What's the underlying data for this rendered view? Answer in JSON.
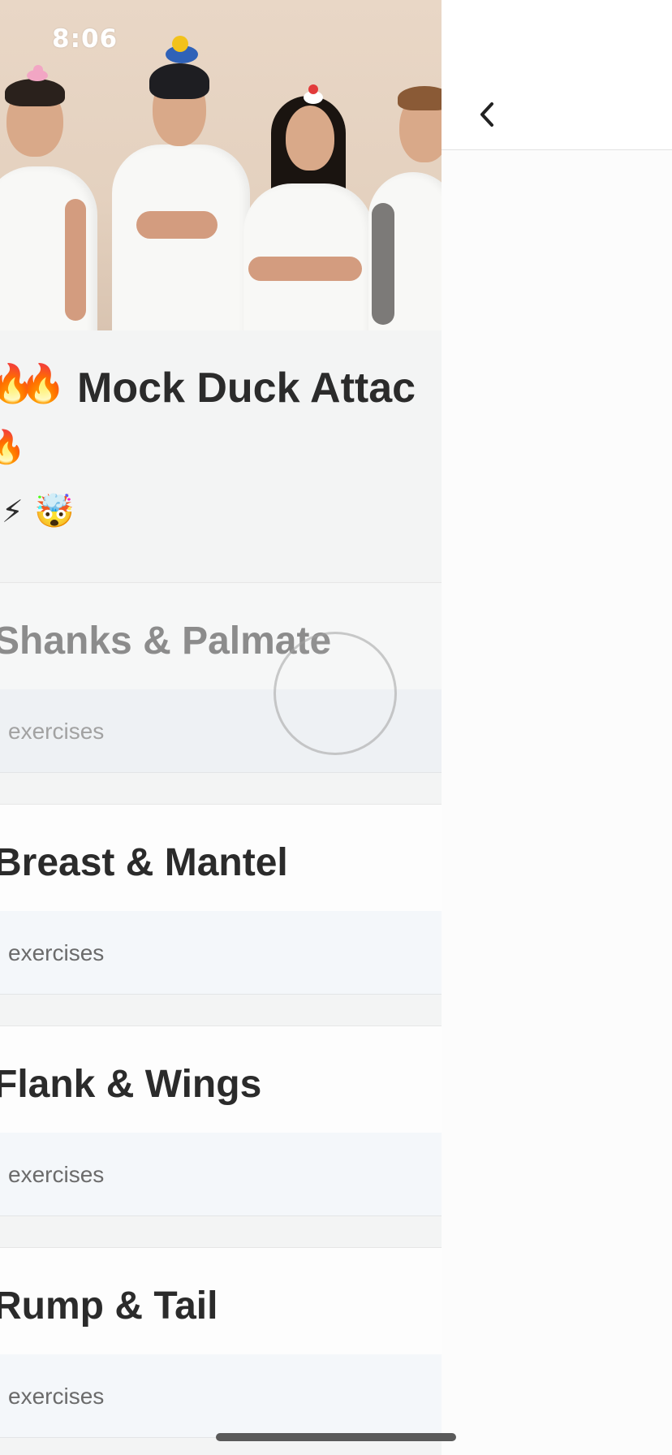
{
  "status_bar": {
    "time": "8:06"
  },
  "course": {
    "title": "Mock Duck Attac",
    "title_emoji_lead_1": "🔥",
    "title_emoji_lead_2": "🔥",
    "title_emoji_wrap": "🔥",
    "badges": [
      "⚡",
      "🤯"
    ]
  },
  "sections": [
    {
      "title": "Shanks & Palmate",
      "count_label": "exercises"
    },
    {
      "title": "Breast & Mantel",
      "count_label": "exercises"
    },
    {
      "title": "Flank & Wings",
      "count_label": "exercises"
    },
    {
      "title": "Rump & Tail",
      "count_label": "exercises"
    }
  ],
  "nav": {
    "back_icon": "chevron-left-icon"
  },
  "colors": {
    "accent_text": "#2b2b2b",
    "muted_text": "#6b6b6b",
    "section_sub_bg": "#f4f7fa",
    "page_bg": "#f3f4f4"
  }
}
